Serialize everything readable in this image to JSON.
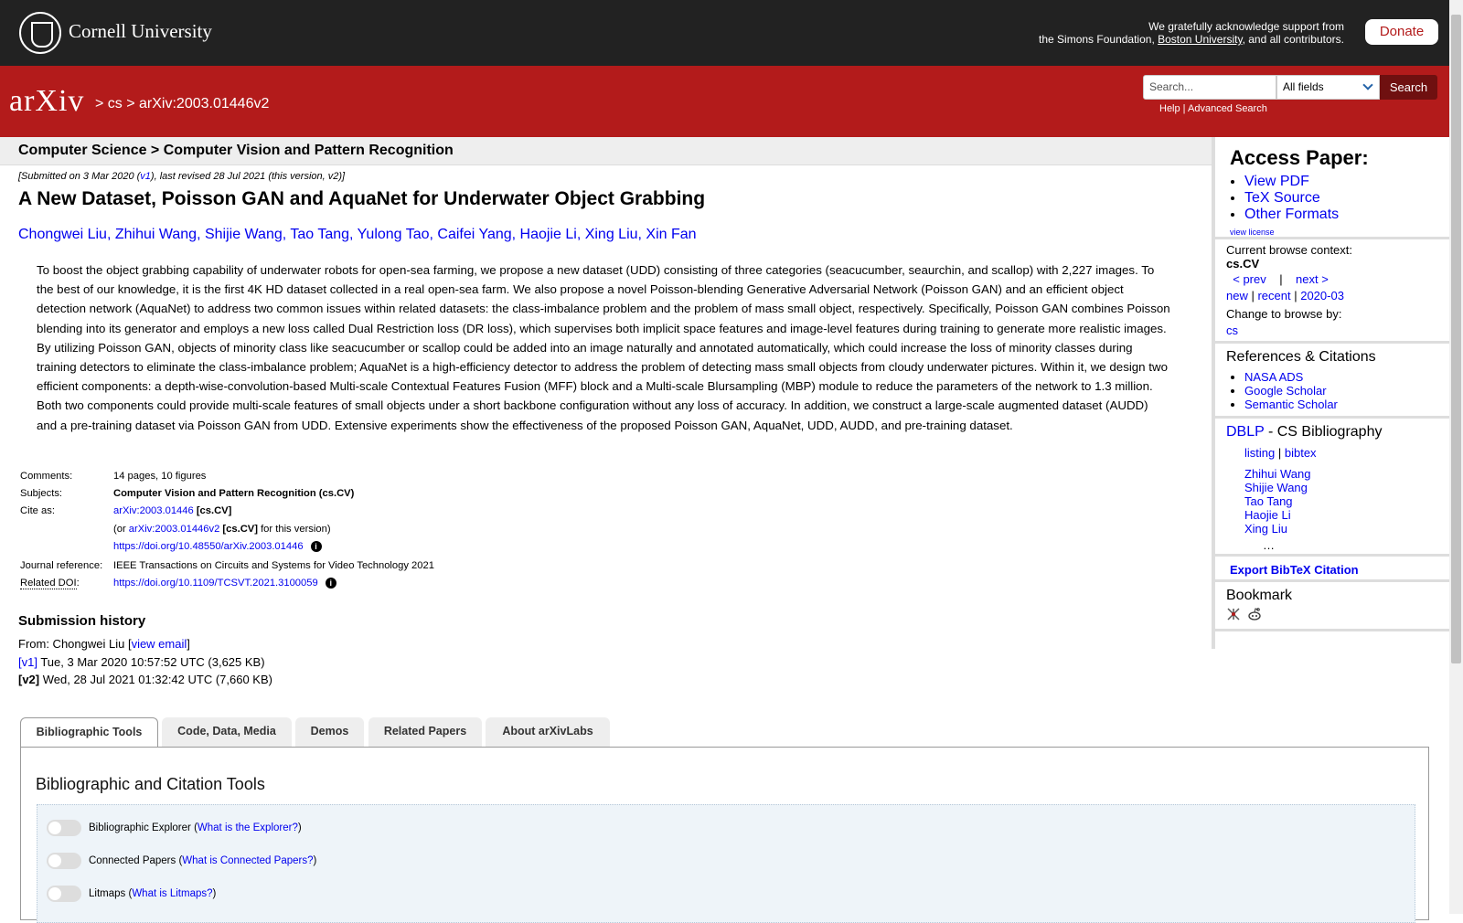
{
  "top": {
    "university": "Cornell University",
    "support_line1": "We gratefully acknowledge support from",
    "support_line2_pre": "the Simons Foundation, ",
    "support_link": "Boston University",
    "support_line2_post": ", and all contributors.",
    "donate": "Donate"
  },
  "header": {
    "logo": "arXiv",
    "crumb_cs": "cs",
    "crumb_id": "arXiv:2003.01446v2",
    "search_placeholder": "Search...",
    "search_field": "All fields",
    "search_button": "Search",
    "help": "Help",
    "advanced": "Advanced Search"
  },
  "paper": {
    "subject_header": "Computer Science > Computer Vision and Pattern Recognition",
    "submitted_pre": "[Submitted on 3 Mar 2020 (",
    "submitted_v1": "v1",
    "submitted_post": "), last revised 28 Jul 2021 (this version, v2)]",
    "title": "A New Dataset, Poisson GAN and AquaNet for Underwater Object Grabbing",
    "authors": [
      "Chongwei Liu",
      "Zhihui Wang",
      "Shijie Wang",
      "Tao Tang",
      "Yulong Tao",
      "Caifei Yang",
      "Haojie Li",
      "Xing Liu",
      "Xin Fan"
    ],
    "abstract": "To boost the object grabbing capability of underwater robots for open-sea farming, we propose a new dataset (UDD) consisting of three categories (seacucumber, seaurchin, and scallop) with 2,227 images. To the best of our knowledge, it is the first 4K HD dataset collected in a real open-sea farm. We also propose a novel Poisson-blending Generative Adversarial Network (Poisson GAN) and an efficient object detection network (AquaNet) to address two common issues within related datasets: the class-imbalance problem and the problem of mass small object, respectively. Specifically, Poisson GAN combines Poisson blending into its generator and employs a new loss called Dual Restriction loss (DR loss), which supervises both implicit space features and image-level features during training to generate more realistic images. By utilizing Poisson GAN, objects of minority class like seacucumber or scallop could be added into an image naturally and annotated automatically, which could increase the loss of minority classes during training detectors to eliminate the class-imbalance problem; AquaNet is a high-efficiency detector to address the problem of detecting mass small objects from cloudy underwater pictures. Within it, we design two efficient components: a depth-wise-convolution-based Multi-scale Contextual Features Fusion (MFF) block and a Multi-scale Blursampling (MBP) module to reduce the parameters of the network to 1.3 million. Both two components could provide multi-scale features of small objects under a short backbone configuration without any loss of accuracy. In addition, we construct a large-scale augmented dataset (AUDD) and a pre-training dataset via Poisson GAN from UDD. Extensive experiments show the effectiveness of the proposed Poisson GAN, AquaNet, UDD, AUDD, and pre-training dataset."
  },
  "meta": {
    "comments_label": "Comments:",
    "comments": "14 pages, 10 figures",
    "subjects_label": "Subjects:",
    "subjects": "Computer Vision and Pattern Recognition (cs.CV)",
    "cite_label": "Cite as:",
    "cite_link": "arXiv:2003.01446",
    "cite_tag": "[cs.CV]",
    "cite2_pre": "(or ",
    "cite2_link": "arXiv:2003.01446v2",
    "cite2_tag": "[cs.CV]",
    "cite2_post": " for this version)",
    "doi_link": "https://doi.org/10.48550/arXiv.2003.01446",
    "journal_label": "Journal reference:",
    "journal": "IEEE Transactions on Circuits and Systems for Video Technology 2021",
    "related_label": "Related DOI",
    "related_colon": ":",
    "related_doi": "https://doi.org/10.1109/TCSVT.2021.3100059",
    "info": "i"
  },
  "history": {
    "title": "Submission history",
    "from_pre": "From: Chongwei Liu [",
    "view_email": "view email",
    "from_post": "]",
    "v1_label": "[v1]",
    "v1": " Tue, 3 Mar 2020 10:57:52 UTC (3,625 KB)",
    "v2_label": "[v2]",
    "v2": " Wed, 28 Jul 2021 01:32:42 UTC (7,660 KB)"
  },
  "sidebar": {
    "access_title": "Access Paper:",
    "access_links": [
      "View PDF",
      "TeX Source",
      "Other Formats"
    ],
    "view_license": "view license",
    "browse_context_label": "Current browse context:",
    "browse_context": "cs.CV",
    "prev": "< prev",
    "pipe": "|",
    "next": "next >",
    "new": "new",
    "recent": "recent",
    "date": "2020-03",
    "change_label": "Change to browse by:",
    "change_cs": "cs",
    "refs_title": "References & Citations",
    "refs": [
      "NASA ADS",
      "Google Scholar",
      "Semantic Scholar"
    ],
    "dblp": "DBLP",
    "dblp_rest": " - CS Bibliography",
    "listing": "listing",
    "bibtex": "bibtex",
    "dblp_authors": [
      "Zhihui Wang",
      "Shijie Wang",
      "Tao Tang",
      "Haojie Li",
      "Xing Liu"
    ],
    "ellipsis": "…",
    "export": "Export BibTeX Citation",
    "bookmark": "Bookmark"
  },
  "tabs": {
    "items": [
      "Bibliographic Tools",
      "Code, Data, Media",
      "Demos",
      "Related Papers",
      "About arXivLabs"
    ],
    "panel_title": "Bibliographic and Citation Tools",
    "tools": [
      {
        "label": "Bibliographic Explorer",
        "link": "What is the Explorer?"
      },
      {
        "label": "Connected Papers",
        "link": "What is Connected Papers?"
      },
      {
        "label": "Litmaps",
        "link": "What is Litmaps?"
      }
    ]
  },
  "colors": {
    "brand_red": "#b31b1b",
    "top_dark": "#222222",
    "link": "#0000ee"
  }
}
